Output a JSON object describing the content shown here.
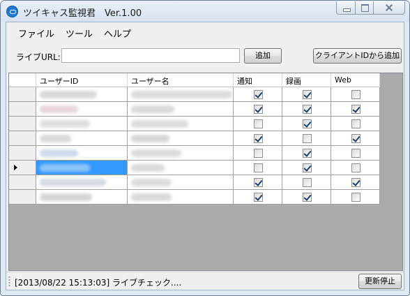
{
  "window": {
    "title": "ツイキャス監視君　Ver.1.00"
  },
  "menu": [
    "ファイル",
    "ツール",
    "ヘルプ"
  ],
  "url_bar": {
    "label": "ライブURL:",
    "value": "",
    "add_label": "追加",
    "client_add_label": "クライアントIDから追加"
  },
  "table": {
    "columns": [
      "ユーザーID",
      "ユーザー名",
      "通知",
      "録画",
      "Web"
    ],
    "selected_row": 5,
    "rows": [
      {
        "notify": true,
        "record": true,
        "web": false
      },
      {
        "notify": true,
        "record": true,
        "web": true
      },
      {
        "notify": false,
        "record": true,
        "web": false
      },
      {
        "notify": true,
        "record": false,
        "web": true
      },
      {
        "notify": false,
        "record": true,
        "web": false
      },
      {
        "notify": false,
        "record": true,
        "web": false
      },
      {
        "notify": true,
        "record": false,
        "web": true
      },
      {
        "notify": true,
        "record": true,
        "web": false
      }
    ]
  },
  "status": {
    "text": "[2013/08/22 15:13:03] ライブチェック....",
    "stop_label": "更新停止"
  }
}
